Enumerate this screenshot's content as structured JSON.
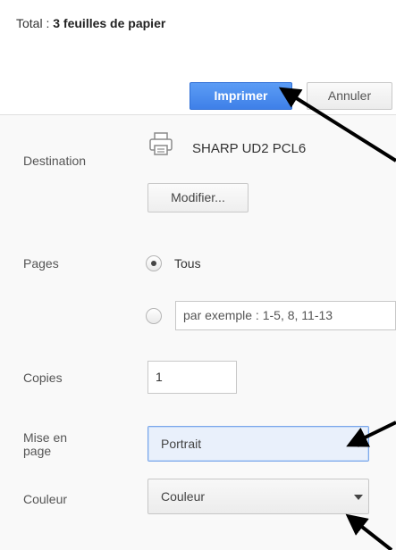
{
  "summary": {
    "total_label": "Total :",
    "total_value": "3 feuilles de papier"
  },
  "actions": {
    "print_label": "Imprimer",
    "cancel_label": "Annuler"
  },
  "destination": {
    "label": "Destination",
    "printer_name": "SHARP UD2 PCL6",
    "change_label": "Modifier..."
  },
  "pages": {
    "label": "Pages",
    "all_label": "Tous",
    "all_selected": true,
    "custom_placeholder": "par exemple : 1-5, 8, 11-13",
    "custom_selected": false
  },
  "copies": {
    "label": "Copies",
    "value": "1"
  },
  "layout": {
    "label_line1": "Mise en",
    "label_line2": "page",
    "selected": "Portrait"
  },
  "color": {
    "label": "Couleur",
    "selected": "Couleur"
  },
  "colors": {
    "primary": "#4a8af4",
    "panel_bg": "#f9f9f9",
    "arrow": "#000000"
  },
  "icons": [
    "printer-icon",
    "dropdown-arrow-icon",
    "annotation-arrow"
  ]
}
